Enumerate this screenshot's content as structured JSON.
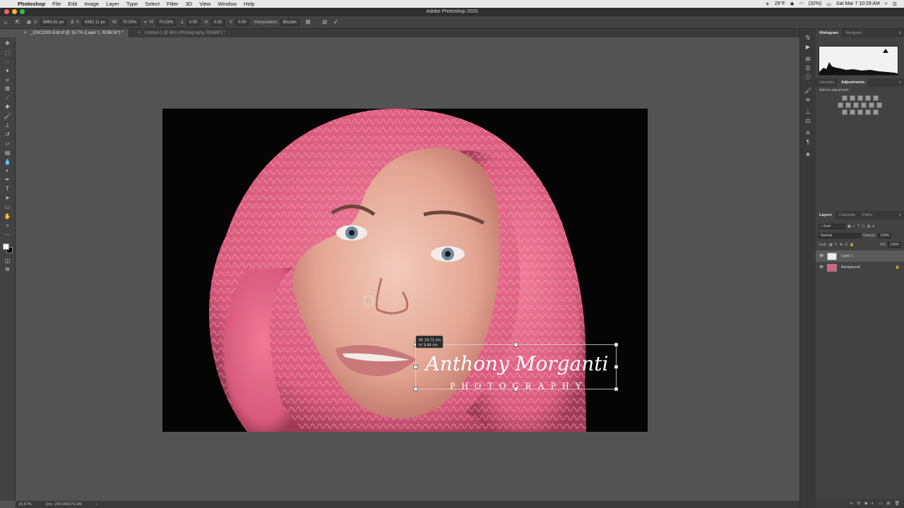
{
  "menubar": {
    "app": "Photoshop",
    "items": [
      "File",
      "Edit",
      "Image",
      "Layer",
      "Type",
      "Select",
      "Filter",
      "3D",
      "View",
      "Window",
      "Help"
    ],
    "status": {
      "temp": "29°F",
      "battery": "(32%)",
      "datetime": "Sat Mar 7  10:29 AM"
    }
  },
  "window": {
    "title": "Adobe Photoshop 2020"
  },
  "options": {
    "x_label": "X:",
    "x_value": "5963.81 px",
    "y_label": "Y:",
    "y_value": "4392.11 px",
    "w_label": "W:",
    "w_value": "70.03%",
    "h_label": "H:",
    "h_value": "70.03%",
    "angle_value": "0.00",
    "hskew_label": "H:",
    "hskew_value": "0.00",
    "vskew_label": "V:",
    "vskew_value": "0.00",
    "interp_label": "Interpolation:",
    "interp_value": "Bicubic"
  },
  "tabs": [
    {
      "label": "_DSC2002-Edit.tif @ 16.7% (Layer 1, RGB/16*) *"
    },
    {
      "label": "Untitled-1 @ 66% (Photography, RGB/8*) *"
    }
  ],
  "transform": {
    "w_readout": "W: 24.71 cm",
    "h_readout": "H:   5.64 cm",
    "signature_line1": "Anthony Morganti",
    "signature_line2": "PHOTOGRAPHY"
  },
  "status": {
    "zoom": "16.67%",
    "doc": "Doc: 290.0M/276.0M"
  },
  "panels": {
    "top_tabs": [
      "Histogram",
      "Navigator"
    ],
    "mid_tabs": [
      "Libraries",
      "Adjustments"
    ],
    "adjust_label": "Add an adjustment",
    "layer_tabs": [
      "Layers",
      "Channels",
      "Paths"
    ],
    "kind_label": "Kind",
    "blend_mode": "Normal",
    "opacity_label": "Opacity:",
    "opacity_value": "100%",
    "lock_label": "Lock:",
    "fill_label": "Fill:",
    "fill_value": "100%",
    "layers": [
      {
        "name": "Layer 1"
      },
      {
        "name": "Background"
      }
    ]
  },
  "colors": {
    "accent": "#e9698c",
    "panel": "#424242",
    "canvas": "#535353"
  }
}
